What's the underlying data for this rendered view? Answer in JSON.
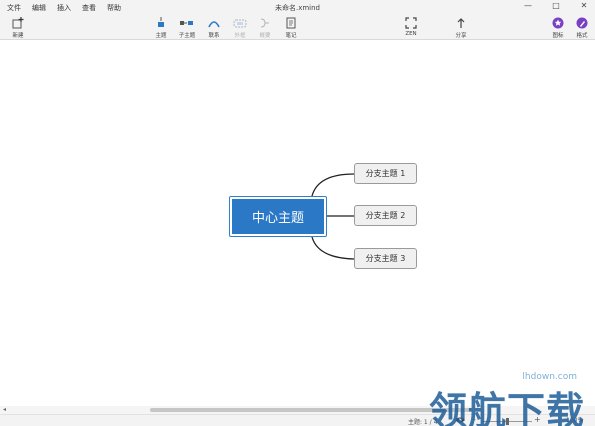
{
  "window": {
    "title": "未命名.xmind",
    "controls": [
      "—",
      "□",
      "✕"
    ]
  },
  "menu": [
    "文件",
    "编辑",
    "插入",
    "查看",
    "帮助"
  ],
  "toolbar": {
    "new": "新建",
    "topic": "主题",
    "subtopic": "子主题",
    "relationship": "联系",
    "boundary": "外框",
    "summary": "概要",
    "note": "笔记",
    "zen": "ZEN",
    "share": "分享",
    "icon": "图标",
    "format": "格式"
  },
  "mindmap": {
    "central": "中心主题",
    "branches": [
      "分支主题 1",
      "分支主题 2",
      "分支主题 3"
    ]
  },
  "status": {
    "topic_count": "主题: 1 / 4",
    "zoom_out": "–",
    "zoom_in": "+",
    "zoom_level": "100%"
  },
  "watermark": {
    "url": "lhdown.com",
    "text": "领航下载"
  },
  "colors": {
    "central_fill": "#2b78c6",
    "accent_purple": "#7b3fc4",
    "toolbar_bg": "#f3f3f3"
  }
}
